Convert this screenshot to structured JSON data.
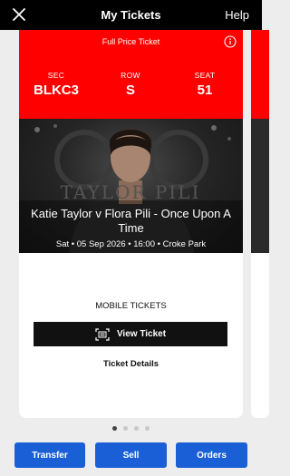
{
  "header": {
    "title": "My Tickets",
    "help_label": "Help",
    "close_icon": "close-icon"
  },
  "ticket": {
    "price_type": "Full Price Ticket",
    "section_label": "SEC",
    "section": "BLKC3",
    "row_label": "ROW",
    "row": "S",
    "seat_label": "SEAT",
    "seat": "51",
    "event_title": "Katie Taylor v Flora Pili - Once Upon A Time",
    "event_meta": "Sat • 05 Sep 2026 • 16:00 • Croke Park",
    "mobile_label": "MOBILE TICKETS",
    "view_label": "View Ticket",
    "details_label": "Ticket Details"
  },
  "pagination": {
    "count": 4,
    "active": 0
  },
  "actions": {
    "transfer": "Transfer",
    "sell": "Sell",
    "orders": "Orders"
  },
  "colors": {
    "accent": "#ff0000",
    "button": "#1a5fd6",
    "bar": "#000000"
  }
}
